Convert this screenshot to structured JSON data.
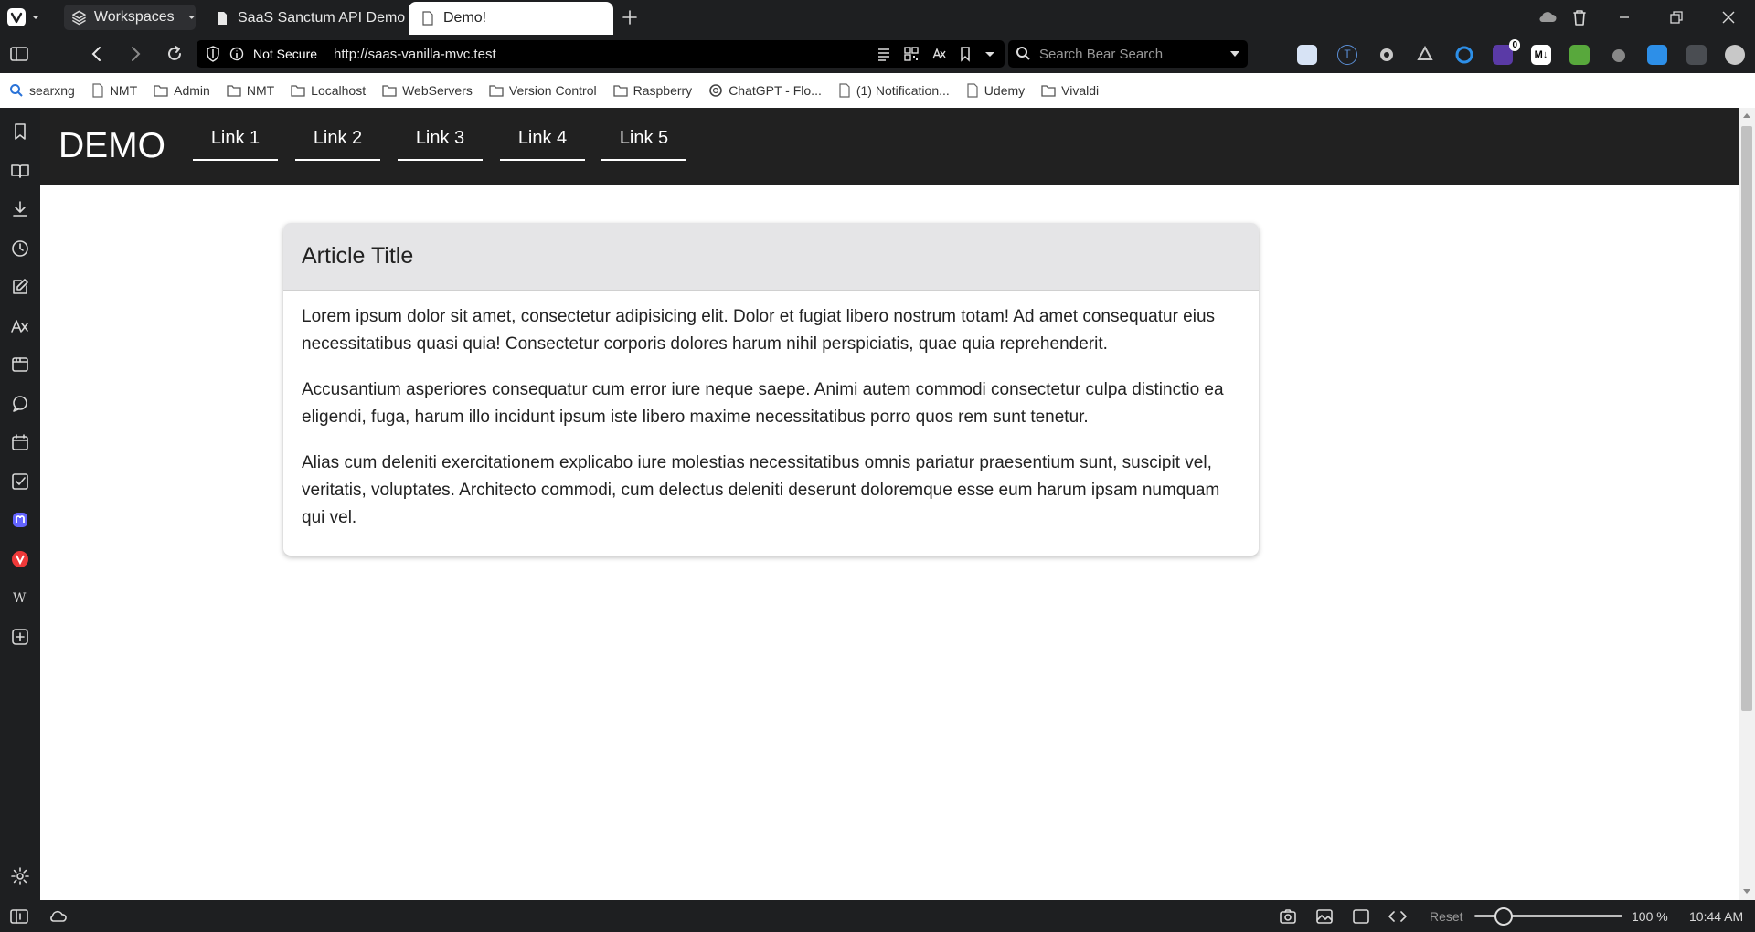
{
  "browser": {
    "workspaces_label": "Workspaces",
    "tabs": [
      {
        "title": "SaaS Sanctum API Demo"
      },
      {
        "title": "Demo!"
      }
    ],
    "address": {
      "security_label": "Not Secure",
      "url": "http://saas-vanilla-mvc.test"
    },
    "search": {
      "placeholder": "Search Bear Search"
    },
    "extension_badge": "0",
    "extension_md_label": "M↓"
  },
  "bookmarks": [
    {
      "label": "searxng",
      "icon": "search-icon"
    },
    {
      "label": "NMT",
      "icon": "page-icon"
    },
    {
      "label": "Admin",
      "icon": "folder-icon"
    },
    {
      "label": "NMT",
      "icon": "folder-icon"
    },
    {
      "label": "Localhost",
      "icon": "folder-icon"
    },
    {
      "label": "WebServers",
      "icon": "folder-icon"
    },
    {
      "label": "Version Control",
      "icon": "folder-icon"
    },
    {
      "label": "Raspberry",
      "icon": "folder-icon"
    },
    {
      "label": "ChatGPT - Flo...",
      "icon": "chatgpt-icon"
    },
    {
      "label": "(1) Notification...",
      "icon": "page-icon"
    },
    {
      "label": "Udemy",
      "icon": "page-icon"
    },
    {
      "label": "Vivaldi",
      "icon": "folder-icon"
    }
  ],
  "site": {
    "brand": "DEMO",
    "nav_links": [
      "Link 1",
      "Link 2",
      "Link 3",
      "Link 4",
      "Link 5"
    ]
  },
  "article": {
    "title": "Article Title",
    "paragraphs": [
      "Lorem ipsum dolor sit amet, consectetur adipisicing elit. Dolor et fugiat libero nostrum totam! Ad amet consequatur eius necessitatibus quasi quia! Consectetur corporis dolores harum nihil perspiciatis, quae quia reprehenderit.",
      "Accusantium asperiores consequatur cum error iure neque saepe. Animi autem commodi consectetur culpa distinctio ea eligendi, fuga, harum illo incidunt ipsum iste libero maxime necessitatibus porro quos rem sunt tenetur.",
      "Alias cum deleniti exercitationem explicabo iure molestias necessitatibus omnis pariatur praesentium sunt, suscipit vel, veritatis, voluptates. Architecto commodi, cum delectus deleniti deserunt doloremque esse eum harum ipsam numquam qui vel."
    ]
  },
  "statusbar": {
    "reset_label": "Reset",
    "zoom": "100 %",
    "clock": "10:44 AM"
  },
  "colors": {
    "browser_chrome": "#1e1f21",
    "site_nav": "#212121",
    "card_header": "#e5e5e7"
  }
}
